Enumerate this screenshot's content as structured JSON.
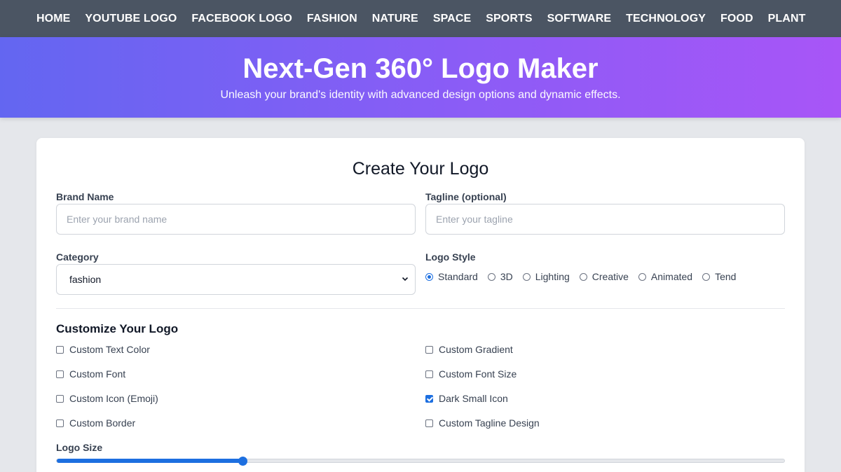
{
  "nav": {
    "items": [
      "HOME",
      "YOUTUBE LOGO",
      "FACEBOOK LOGO",
      "FASHION",
      "NATURE",
      "SPACE",
      "SPORTS",
      "SOFTWARE",
      "TECHNOLOGY",
      "FOOD",
      "PLANT"
    ]
  },
  "hero": {
    "title": "Next-Gen 360° Logo Maker",
    "subtitle": "Unleash your brand's identity with advanced design options and dynamic effects."
  },
  "form": {
    "title": "Create Your Logo",
    "brand_name": {
      "label": "Brand Name",
      "placeholder": "Enter your brand name",
      "value": ""
    },
    "tagline": {
      "label": "Tagline (optional)",
      "placeholder": "Enter your tagline",
      "value": ""
    },
    "category": {
      "label": "Category",
      "selected": "fashion"
    },
    "logo_style": {
      "label": "Logo Style",
      "options": [
        "Standard",
        "3D",
        "Lighting",
        "Creative",
        "Animated",
        "Tend"
      ],
      "selected": "Standard"
    },
    "customize": {
      "title": "Customize Your Logo",
      "left": [
        {
          "label": "Custom Text Color",
          "checked": false
        },
        {
          "label": "Custom Font",
          "checked": false
        },
        {
          "label": "Custom Icon (Emoji)",
          "checked": false
        },
        {
          "label": "Custom Border",
          "checked": false
        }
      ],
      "right": [
        {
          "label": "Custom Gradient",
          "checked": false
        },
        {
          "label": "Custom Font Size",
          "checked": false
        },
        {
          "label": "Dark Small Icon",
          "checked": true
        },
        {
          "label": "Custom Tagline Design",
          "checked": false
        }
      ]
    },
    "logo_size": {
      "label": "Logo Size",
      "fraction": 0.255
    }
  },
  "colors": {
    "nav_bg": "#4b5563",
    "hero_gradient_start": "#6366f1",
    "hero_gradient_end": "#a855f7",
    "accent": "#1d6fe0"
  }
}
